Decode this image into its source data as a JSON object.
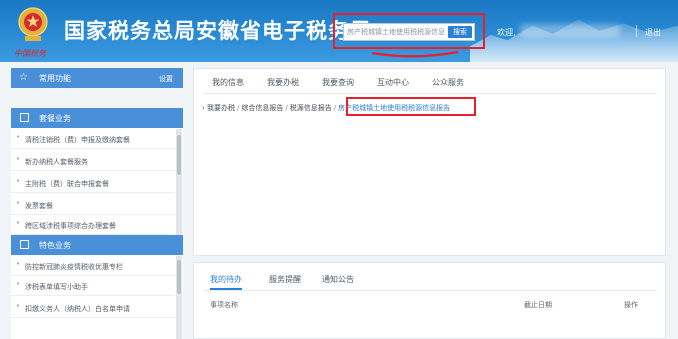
{
  "header": {
    "title": "国家税务总局安徽省电子税务局",
    "logo_text": "中国税务",
    "search": {
      "value": "房产税城镇土地使用税税源信息",
      "button_label": "搜索"
    },
    "welcome_label": "欢迎,",
    "logout_label": "退出"
  },
  "sidebar": {
    "header_label": "常用功能",
    "settings_label": "设置",
    "section1_label": "套餐业务",
    "section1_items": [
      "清税注销税（费）申报及缴纳套餐",
      "新办纳税人套餐服务",
      "主附税（费）联合申报套餐",
      "发票套餐",
      "跨区域涉税事项综合办理套餐"
    ],
    "section2_label": "特色业务",
    "section2_items": [
      "防控新冠肺炎疫情税收优惠专栏",
      "涉税表单填写小助手",
      "扣缴义务人（纳税人）白名单申请"
    ]
  },
  "main": {
    "tabs": [
      "我的信息",
      "我要办税",
      "我要查询",
      "互动中心",
      "公众服务"
    ],
    "breadcrumb": {
      "parts": [
        "我要办税",
        "综合信息报告",
        "税源信息报告"
      ],
      "current": "房产税城镇土地使用税税源信息报告"
    }
  },
  "todo": {
    "tabs": [
      "我的待办",
      "服务提醒",
      "通知公告"
    ],
    "columns": {
      "name": "事项名称",
      "deadline": "截止日期",
      "action": "操作"
    }
  },
  "colors": {
    "header_blue": "#2a8ad3",
    "sidebar_blue": "#4a90d9",
    "highlight_red": "#e8202a",
    "link_blue": "#2d7fd6"
  }
}
